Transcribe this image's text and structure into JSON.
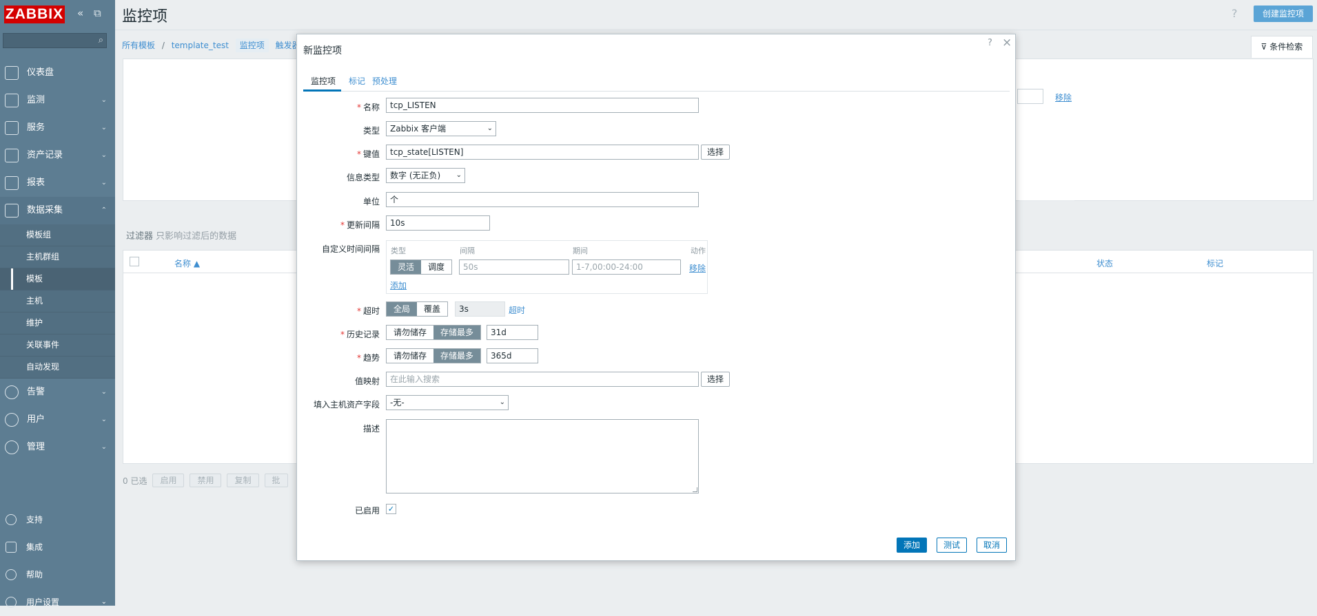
{
  "sidebar": {
    "logo": "ZABBIX",
    "collapse_icon": "«",
    "expand_icon": "⧉",
    "search_icon": "⌕",
    "menu": [
      {
        "label": "仪表盘",
        "icon": "dashboard-icon"
      },
      {
        "label": "监测",
        "icon": "monitoring-icon"
      },
      {
        "label": "服务",
        "icon": "services-icon"
      },
      {
        "label": "资产记录",
        "icon": "inventory-icon"
      },
      {
        "label": "报表",
        "icon": "reports-icon"
      },
      {
        "label": "数据采集",
        "icon": "data-collection-icon"
      }
    ],
    "submenu": [
      "模板组",
      "主机群组",
      "模板",
      "主机",
      "维护",
      "关联事件",
      "自动发现"
    ],
    "menu2": [
      {
        "label": "告警",
        "icon": "alerts-icon"
      },
      {
        "label": "用户",
        "icon": "users-icon"
      },
      {
        "label": "管理",
        "icon": "administration-icon"
      }
    ],
    "bottom": [
      "支持",
      "集成",
      "帮助",
      "用户设置"
    ]
  },
  "main": {
    "title": "监控项",
    "help": "?",
    "create_button": "创建监控项",
    "breadcrumbs": [
      "所有模板",
      "/",
      "template_test",
      "监控项",
      "触发器"
    ],
    "filter_tab": "条件检索",
    "filter_remove": "移除",
    "filter_label": "过滤器",
    "filter_hint": "只影响过滤后的数据",
    "table_headers": {
      "name": "名称 ▲",
      "status": "状态",
      "tags": "标记"
    },
    "selected": "0 已选",
    "actions": [
      "启用",
      "禁用",
      "复制",
      "批"
    ]
  },
  "modal": {
    "title": "新监控项",
    "help": "?",
    "close": "×",
    "tabs": [
      "监控项",
      "标记",
      "预处理"
    ],
    "labels": {
      "name": "名称",
      "type": "类型",
      "key": "键值",
      "info_type": "信息类型",
      "units": "单位",
      "interval": "更新间隔",
      "custom_intervals": "自定义时间间隔",
      "timeout": "超时",
      "history": "历史记录",
      "trends": "趋势",
      "valuemap": "值映射",
      "inventory": "填入主机资产字段",
      "description": "描述",
      "enabled": "已启用"
    },
    "values": {
      "name": "tcp_LISTEN",
      "type": "Zabbix 客户端",
      "key": "tcp_state[LISTEN]",
      "info_type": "数字 (无正负)",
      "units": "个",
      "interval": "10s",
      "timeout": "3s",
      "history": "31d",
      "trends": "365d",
      "inventory": "-无-"
    },
    "placeholders": {
      "ci_interval": "50s",
      "ci_period": "1-7,00:00-24:00",
      "valuemap": "在此输入搜索"
    },
    "select_button": "选择",
    "custom_intervals": {
      "headers": [
        "类型",
        "间隔",
        "期间",
        "动作"
      ],
      "flexible": "灵活",
      "scheduling": "调度",
      "remove": "移除",
      "add": "添加"
    },
    "timeout_options": [
      "全局",
      "覆盖"
    ],
    "timeout_link": "超时",
    "storage_options": [
      "请勿储存",
      "存储最多"
    ],
    "checkmark": "✓",
    "buttons": {
      "add": "添加",
      "test": "测试",
      "cancel": "取消"
    }
  }
}
